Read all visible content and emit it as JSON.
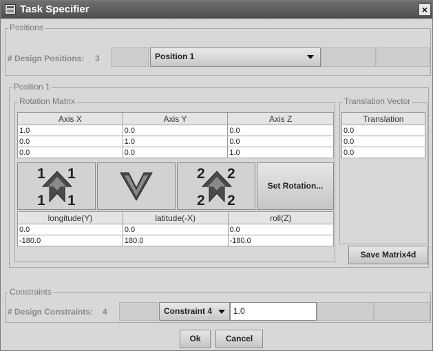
{
  "window": {
    "title": "Task Specifier",
    "close_glyph": "×"
  },
  "positions": {
    "legend": "Positions",
    "count_label": "# Design Positions:",
    "count_value": "3",
    "selected": "Position 1"
  },
  "position_panel": {
    "legend": "Position 1",
    "rotation_matrix": {
      "legend": "Rotation Matrix",
      "headers": [
        "Axis X",
        "Axis Y",
        "Axis Z"
      ],
      "rows": [
        [
          "1.0",
          "0.0",
          "0.0"
        ],
        [
          "0.0",
          "1.0",
          "0.0"
        ],
        [
          "0.0",
          "0.0",
          "1.0"
        ]
      ]
    },
    "rotation_buttons": {
      "btn1_nums": [
        "1",
        "1",
        "1",
        "1"
      ],
      "btn3_nums": [
        "2",
        "2",
        "2",
        "2"
      ],
      "set_rotation_label": "Set Rotation..."
    },
    "angles": {
      "headers": [
        "longitude(Y)",
        "latitude(-X)",
        "roll(Z)"
      ],
      "rows": [
        [
          "0.0",
          "0.0",
          "0.0"
        ],
        [
          "-180.0",
          "180.0",
          "-180.0"
        ]
      ]
    },
    "translation_vector": {
      "legend": "Translation Vector",
      "header": "Translation",
      "rows": [
        "0.0",
        "0.0",
        "0.0"
      ]
    },
    "save_label": "Save Matrix4d"
  },
  "constraints": {
    "legend": "Constraints",
    "count_label": "# Design Constraints:",
    "count_value": "4",
    "selected": "Constraint 4",
    "value": "1.0"
  },
  "footer": {
    "ok_label": "Ok",
    "cancel_label": "Cancel"
  },
  "icons": [
    "app-icon",
    "close-icon",
    "rotate-up-arrow-icon",
    "rotate-down-arrow-icon",
    "dropdown-arrow-icon"
  ]
}
